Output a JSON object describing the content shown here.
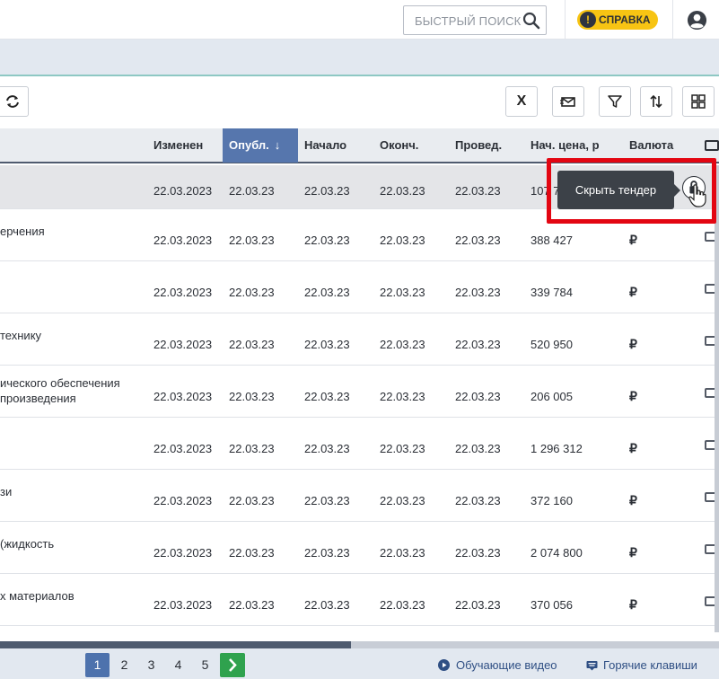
{
  "header": {
    "search_placeholder": "БЫСТРЫЙ ПОИСК",
    "help_label": "СПРАВКА",
    "help_icon_glyph": "!"
  },
  "toolbar": {
    "excel_label": "X"
  },
  "table": {
    "columns": {
      "changed": "Изменен",
      "published": "Опубл.",
      "start": "Начало",
      "end": "Оконч.",
      "held": "Провед.",
      "price": "Нач. цена, р",
      "currency": "Валюта"
    },
    "sort_arrow": "↓",
    "rows": [
      {
        "name1": "",
        "name2": "",
        "changed": "22.03.2023",
        "published": "22.03.23",
        "start": "22.03.23",
        "end": "22.03.23",
        "held": "22.03.23",
        "price": "107 7",
        "currency": ""
      },
      {
        "name1": "ерчения",
        "name2": "",
        "changed": "22.03.2023",
        "published": "22.03.23",
        "start": "22.03.23",
        "end": "22.03.23",
        "held": "22.03.23",
        "price": "388 427",
        "currency": "₽"
      },
      {
        "name1": "",
        "name2": "",
        "changed": "22.03.2023",
        "published": "22.03.23",
        "start": "22.03.23",
        "end": "22.03.23",
        "held": "22.03.23",
        "price": "339 784",
        "currency": "₽"
      },
      {
        "name1": "технику",
        "name2": "",
        "changed": "22.03.2023",
        "published": "22.03.23",
        "start": "22.03.23",
        "end": "22.03.23",
        "held": "22.03.23",
        "price": "520 950",
        "currency": "₽"
      },
      {
        "name1": "ического обеспечения",
        "name2": "произведения",
        "changed": "22.03.2023",
        "published": "22.03.23",
        "start": "22.03.23",
        "end": "22.03.23",
        "held": "22.03.23",
        "price": "206 005",
        "currency": "₽"
      },
      {
        "name1": "",
        "name2": "",
        "changed": "22.03.2023",
        "published": "22.03.23",
        "start": "22.03.23",
        "end": "22.03.23",
        "held": "22.03.23",
        "price": "1 296 312",
        "currency": "₽"
      },
      {
        "name1": "зи",
        "name2": "",
        "changed": "22.03.2023",
        "published": "22.03.23",
        "start": "22.03.23",
        "end": "22.03.23",
        "held": "22.03.23",
        "price": "372 160",
        "currency": "₽"
      },
      {
        "name1": "(жидкость",
        "name2": "",
        "changed": "22.03.2023",
        "published": "22.03.23",
        "start": "22.03.23",
        "end": "22.03.23",
        "held": "22.03.23",
        "price": "2 074 800",
        "currency": "₽"
      },
      {
        "name1": "х материалов",
        "name2": "",
        "changed": "22.03.2023",
        "published": "22.03.23",
        "start": "22.03.23",
        "end": "22.03.23",
        "held": "22.03.23",
        "price": "370 056",
        "currency": "₽"
      }
    ]
  },
  "tooltip": {
    "text": "Скрыть тендер"
  },
  "pagination": {
    "pages": [
      "1",
      "2",
      "3",
      "4",
      "5"
    ],
    "current": "1"
  },
  "footer": {
    "video_link": "Обучающие видео",
    "hotkeys_link": "Горячие клавиши"
  },
  "colors": {
    "accent": "#4d72ad",
    "sorted_header": "#5676ad",
    "highlight_box": "#e30612",
    "help_badge": "#f7c413",
    "next_button": "#2fa24e"
  }
}
